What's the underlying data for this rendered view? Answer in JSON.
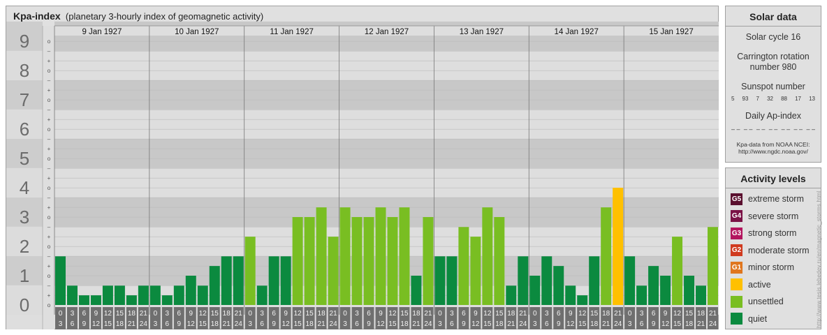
{
  "header": {
    "title": "Kpa-index",
    "subtitle": "(planetary 3-hourly index of geomagnetic activity)"
  },
  "chart_data": {
    "type": "bar",
    "y_major_labels": [
      "0",
      "1",
      "2",
      "3",
      "4",
      "5",
      "6",
      "7",
      "8",
      "9"
    ],
    "y_minor_labels": [
      "o",
      "+",
      "–"
    ],
    "days": [
      "9 Jan 1927",
      "10 Jan 1927",
      "11 Jan 1927",
      "12 Jan 1927",
      "13 Jan 1927",
      "14 Jan 1927",
      "15 Jan 1927"
    ],
    "interval_starts": [
      "0",
      "3",
      "6",
      "9",
      "12",
      "15",
      "18",
      "21"
    ],
    "interval_ends": [
      "3",
      "6",
      "9",
      "12",
      "15",
      "18",
      "21",
      "24"
    ],
    "ylim": [
      0,
      9.67
    ],
    "values": [
      [
        1.33,
        0.33,
        0,
        0,
        0.33,
        0.33,
        0,
        0.33
      ],
      [
        0.33,
        0,
        0.33,
        0.67,
        0.33,
        1,
        1.33,
        1.33
      ],
      [
        2,
        0.33,
        1.33,
        1.33,
        2.67,
        2.67,
        3,
        2
      ],
      [
        3,
        2.67,
        2.67,
        3,
        2.67,
        3,
        0.67,
        2.67
      ],
      [
        1.33,
        1.33,
        2.33,
        2,
        3,
        2.67,
        0.33,
        1.33
      ],
      [
        0.67,
        1.33,
        1,
        0.33,
        0,
        1.33,
        3,
        3.67
      ],
      [
        1.33,
        0.33,
        1,
        0.67,
        2,
        0.67,
        0.33,
        2.33
      ]
    ],
    "colors": {
      "quiet": "#0b8a3f",
      "unsettled": "#79be22",
      "active": "#ffc000",
      "band_dark": "#c8c8c8",
      "band_light": "#dedede",
      "axis_box": "#c8c8c8",
      "label_box": "#6f6f6f"
    }
  },
  "solar": {
    "title": "Solar data",
    "cycle": "Solar cycle 16",
    "carrington_line1": "Carrington rotation",
    "carrington_line2": "number 980",
    "sunspot_title": "Sunspot number",
    "sunspots": [
      "5",
      "93",
      "7",
      "32",
      "88",
      "17",
      "13"
    ],
    "ap_title": "Daily Ap-index",
    "ap_values": [
      "– –",
      "– –",
      "– –",
      "– –",
      "– –",
      "– –",
      "– –"
    ],
    "source_line1": "Kpa-data from NOAA NCEI:",
    "source_line2": "http://www.ngdc.noaa.gov/"
  },
  "activity": {
    "title": "Activity levels",
    "levels": [
      {
        "code": "G5",
        "label": "extreme storm",
        "color": "#5a0f2e"
      },
      {
        "code": "G4",
        "label": "severe storm",
        "color": "#7a1246"
      },
      {
        "code": "G3",
        "label": "strong storm",
        "color": "#b3145e"
      },
      {
        "code": "G2",
        "label": "moderate storm",
        "color": "#d03a1e"
      },
      {
        "code": "G1",
        "label": "minor storm",
        "color": "#e0761e"
      },
      {
        "code": "",
        "label": "active",
        "color": "#ffc000"
      },
      {
        "code": "",
        "label": "unsettled",
        "color": "#79be22"
      },
      {
        "code": "",
        "label": "quiet",
        "color": "#0b8a3f"
      }
    ]
  },
  "watermark": "http://www.tesis.lebedev.ru/en/magnetic_storms.html"
}
